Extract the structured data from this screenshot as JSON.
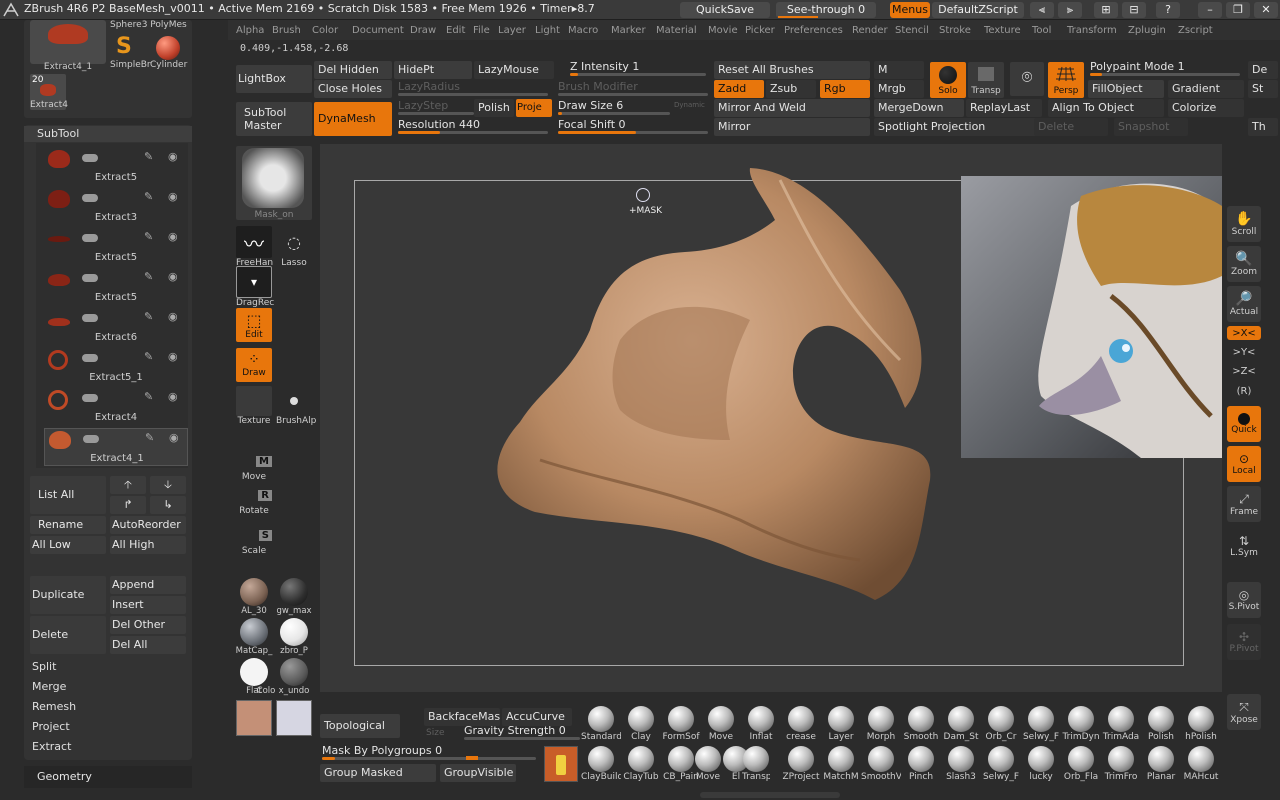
{
  "titlebar": {
    "title": "ZBrush 4R6 P2     BaseMesh_v0011   • Active Mem 2169 • Scratch Disk 1583 • Free Mem 1926 • Timer▸8.7",
    "quicksave": "QuickSave",
    "see_through": "See-through  0",
    "menus": "Menus",
    "script": "DefaultZScript"
  },
  "menubar": [
    "Alpha",
    "Brush",
    "Color",
    "Document",
    "Draw",
    "Edit",
    "File",
    "Layer",
    "Light",
    "Macro",
    "Marker",
    "Material",
    "Movie",
    "Picker",
    "Preferences",
    "Render",
    "Stencil",
    "Stroke",
    "Texture",
    "Tool",
    "Transform",
    "Zplugin",
    "Zscript"
  ],
  "coords": "0.409,-1.458,-2.68",
  "top_tools": {
    "thumb1_label": "Extract4_1",
    "sphere_label": "Sphere3 PolyMes",
    "simplebr_label": "SimpleBr",
    "cylinder_label": "Cylinder",
    "small_count": "20",
    "small_label": "Extract4"
  },
  "shelf": {
    "lightbox": "LightBox",
    "subtool_master": "SubTool Master",
    "dynamesh": "DynaMesh",
    "del_hidden": "Del Hidden",
    "close_holes": "Close Holes",
    "hidept": "HidePt",
    "lazymouse": "LazyMouse",
    "lazyradius": "LazyRadius",
    "lazystep": "LazyStep",
    "polish": "Polish",
    "projec": "Proje",
    "resolution": "Resolution 440",
    "z_intensity": "Z Intensity 1",
    "brush_modifier": "Brush Modifier",
    "draw_size": "Draw Size 6",
    "dynamic": "Dynamic",
    "focal_shift": "Focal Shift 0",
    "reset_all_brushes": "Reset All Brushes",
    "zadd": "Zadd",
    "zsub": "Zsub",
    "rgb": "Rgb",
    "m": "M",
    "mrgb": "Mrgb",
    "mirror_and_weld": "Mirror And Weld",
    "mergedown": "MergeDown",
    "mirror": "Mirror",
    "spotlight": "Spotlight Projection",
    "solo": "Solo",
    "transp": "Transp",
    "persp": "Persp",
    "replaylast": "ReplayLast",
    "polypaint_mode": "Polypaint Mode 1",
    "fillobject": "FillObject",
    "gradient": "Gradient",
    "align_to_object": "Align To Object",
    "colorize": "Colorize",
    "delete_dim": "Delete",
    "snapshot_dim": "Snapshot",
    "de": "De",
    "st": "St",
    "th": "Th"
  },
  "subtool": {
    "header": "SubTool",
    "items": [
      {
        "label": "Extract5",
        "color": "#9b2a1a"
      },
      {
        "label": "Extract3",
        "color": "#7d1f14"
      },
      {
        "label": "Extract5",
        "color": "#6a1a10"
      },
      {
        "label": "Extract5",
        "color": "#8a2516"
      },
      {
        "label": "Extract6",
        "color": "#a0301c"
      },
      {
        "label": "Extract5_1",
        "color": "#b23a1f"
      },
      {
        "label": "Extract4",
        "color": "#c04a26"
      },
      {
        "label": "Extract4_1",
        "color": "#c45a30"
      }
    ],
    "list_all": "List All",
    "rename": "Rename",
    "autoreorder": "AutoReorder",
    "all_low": "All Low",
    "all_high": "All High",
    "duplicate": "Duplicate",
    "append": "Append",
    "insert": "Insert",
    "delete": "Delete",
    "del_other": "Del Other",
    "del_all": "Del All",
    "split": "Split",
    "merge": "Merge",
    "remesh": "Remesh",
    "project": "Project",
    "extract": "Extract",
    "geometry": "Geometry"
  },
  "left_tools": {
    "masked_label": "Mask_on",
    "freehand": "FreeHan",
    "lasso": "Lasso",
    "dragrect": "DragRec",
    "edit": "Edit",
    "draw": "Draw",
    "texture": "Texture",
    "brushalpha": "BrushAlp",
    "move": "Move",
    "rotate": "Rotate",
    "scale": "Scale",
    "move_key": "M",
    "rotate_key": "R",
    "scale_key": "S"
  },
  "materials": [
    {
      "label": "AL_30",
      "color": "#7a6152"
    },
    {
      "label": "gw_max",
      "color": "#2e2e2e"
    },
    {
      "label": "MatCap_",
      "color": "#6a6f76"
    },
    {
      "label": "zbro_P",
      "color": "#e6e6e6"
    },
    {
      "label": "Flat",
      "color": "#f4f4f4"
    },
    {
      "label": "Colo",
      "color": "#2a2a2a"
    },
    {
      "label": "x_undo",
      "color": "#5a5a5a"
    }
  ],
  "swatches": {
    "main": "#c49077",
    "secondary": "#d6d6e2"
  },
  "cursor_label": "+MASK",
  "right_tools": [
    {
      "label": "Scroll",
      "active": false
    },
    {
      "label": "Zoom",
      "active": false
    },
    {
      "label": "Actual",
      "active": false
    },
    {
      "label": ">X<",
      "active": true
    },
    {
      "label": ">Y<",
      "active": false
    },
    {
      "label": ">Z<",
      "active": false
    },
    {
      "label": "(R)",
      "active": false
    },
    {
      "label": "Quick",
      "active": true
    },
    {
      "label": "Local",
      "active": true
    },
    {
      "label": "Frame",
      "active": false
    },
    {
      "label": "L.Sym",
      "active": false
    },
    {
      "label": "S.Pivot",
      "active": false
    },
    {
      "label": "P.Pivot",
      "active": false
    },
    {
      "label": "Xpose",
      "active": false
    }
  ],
  "bottom": {
    "topological": "Topological",
    "backface": "BackfaceMas",
    "accucurve": "AccuCurve",
    "size": "Size",
    "gravity": "Gravity Strength 0",
    "mask_by_polygroups": "Mask By Polygroups 0",
    "group_masked": "Group Masked",
    "groupvisible": "GroupVisible"
  },
  "brushes_row1": [
    "Standard",
    "Clay",
    "FormSof",
    "Move",
    "Inflat",
    "crease",
    "Layer",
    "Morph",
    "Smooth",
    "Dam_St",
    "Orb_Cr",
    "Selwy_F",
    "TrimDyn",
    "TrimAda",
    "Polish",
    "hPolish"
  ],
  "brushes_row2": [
    "ClayBuild",
    "ClayTub",
    "CB_Pain",
    "Move",
    "El",
    "Transpo",
    "ZProject",
    "MatchM",
    "SmoothV",
    "Pinch",
    "Slash3",
    "Selwy_F",
    "lucky",
    "Orb_Fla",
    "TrimFro",
    "Planar",
    "MAHcut"
  ]
}
